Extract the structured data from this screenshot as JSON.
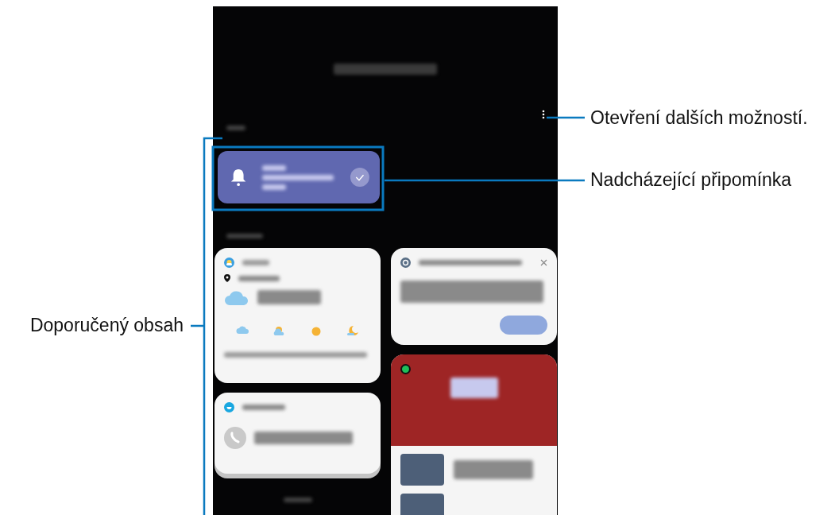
{
  "callouts": [
    {
      "text": "Otevření dalších možností.",
      "kind": "menu"
    },
    {
      "text": "Nadcházející připomínka",
      "kind": "reminder"
    },
    {
      "text": "Doporučený obsah",
      "kind": "cards"
    }
  ]
}
